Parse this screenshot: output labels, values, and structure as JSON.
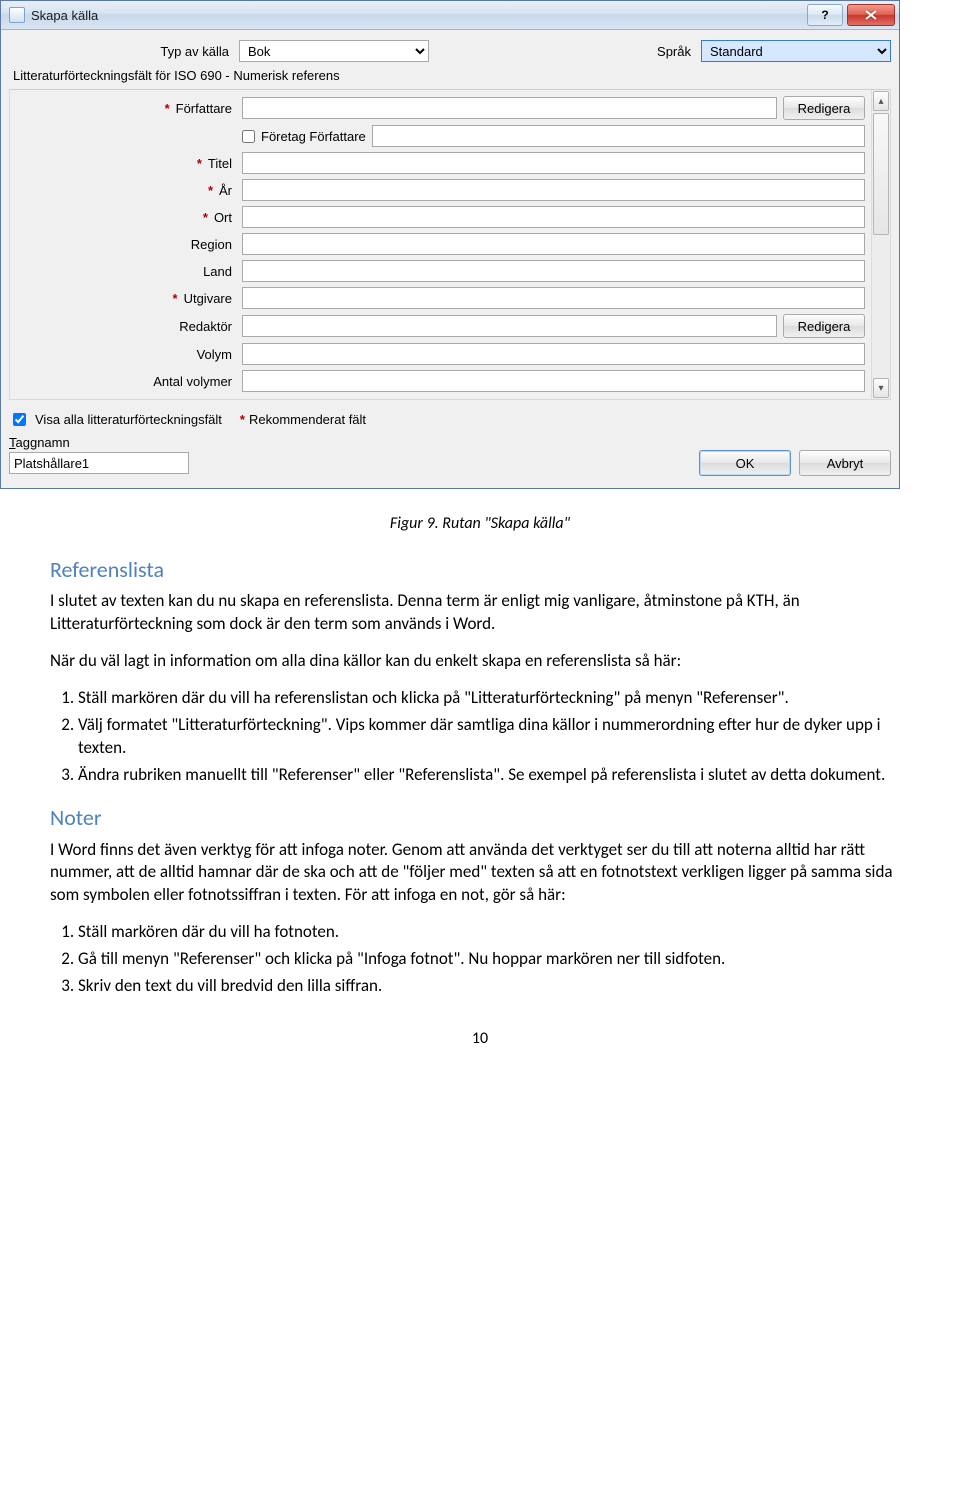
{
  "titlebar": {
    "title": "Skapa källa"
  },
  "topRow": {
    "typeLabel": "Typ av källa",
    "typeValue": "Bok",
    "langLabel": "Språk",
    "langValue": "Standard"
  },
  "sectionLabel": "Litteraturförteckningsfält för ISO 690 - Numerisk referens",
  "fields": {
    "author": {
      "label": "Författare",
      "editBtn": "Redigera"
    },
    "company": {
      "label": "Företag Författare"
    },
    "title": {
      "label": "Titel"
    },
    "year": {
      "label": "År"
    },
    "city": {
      "label": "Ort"
    },
    "region": {
      "label": "Region"
    },
    "country": {
      "label": "Land"
    },
    "publisher": {
      "label": "Utgivare"
    },
    "editor": {
      "label": "Redaktör",
      "editBtn": "Redigera"
    },
    "volume": {
      "label": "Volym"
    },
    "numvols": {
      "label": "Antal volymer"
    }
  },
  "bottom": {
    "showAll": "Visa alla litteraturförteckningsfält",
    "recommended": "Rekommenderat fält",
    "tagnameLabel": "aggnamn",
    "tagnameFirst": "T",
    "tagnameValue": "Platshållare1",
    "ok": "OK",
    "cancel": "Avbryt"
  },
  "doc": {
    "figCaption": "Figur 9. Rutan \"Skapa källa\"",
    "refTitle": "Referenslista",
    "refP1": "I slutet av texten kan du nu skapa en referenslista. Denna term är enligt mig vanligare, åtminstone på KTH, än Litteraturförteckning som dock är den term som används i Word.",
    "refP2": "När du väl lagt in information om alla dina källor kan du enkelt skapa en referenslista så här:",
    "refSteps": [
      "Ställ markören där du vill ha referenslistan och klicka på \"Litteraturförteckning\" på menyn \"Referenser\".",
      "Välj formatet \"Litteraturförteckning\". Vips kommer där samtliga dina källor i nummerordning efter hur de dyker upp i texten.",
      "Ändra rubriken manuellt till \"Referenser\" eller \"Referenslista\". Se exempel på referenslista i slutet av detta dokument."
    ],
    "noterTitle": "Noter",
    "noterP": "I Word finns det även verktyg för att infoga noter. Genom att använda det verktyget ser du till att noterna alltid har rätt nummer, att de alltid hamnar där de ska och att de \"följer med\" texten så att en fotnotstext verkligen ligger på samma sida som symbolen eller fotnotssiffran i texten. För att infoga en not, gör så här:",
    "noterSteps": [
      "Ställ markören där du vill ha fotnoten.",
      "Gå till menyn \"Referenser\" och klicka på \"Infoga fotnot\". Nu hoppar markören ner till sidfoten.",
      "Skriv den text du vill bredvid den lilla siffran."
    ],
    "pageNum": "10"
  }
}
